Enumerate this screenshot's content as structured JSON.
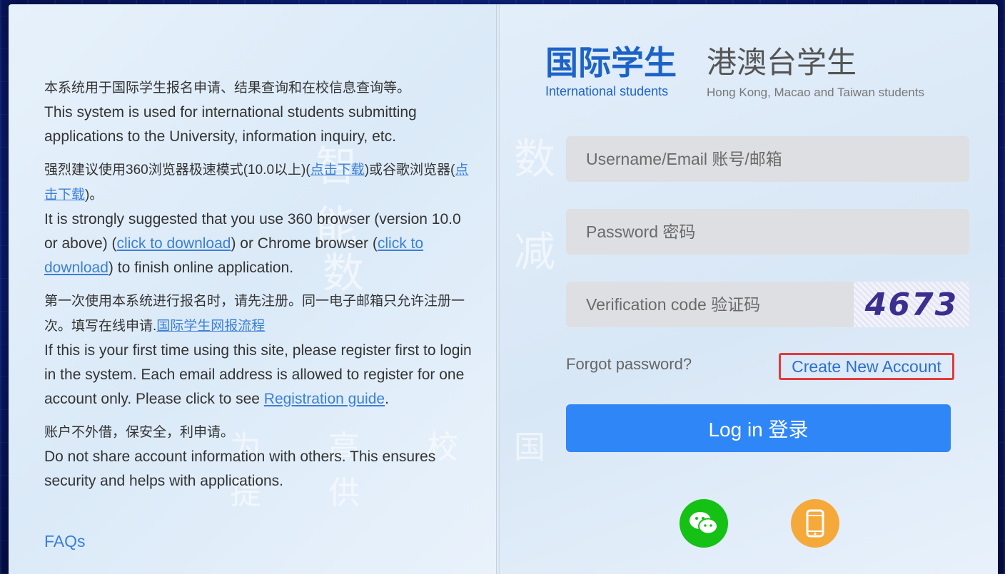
{
  "info": {
    "p1": {
      "cn": "本系统用于国际学生报名申请、结果查询和在校信息查询等。",
      "en": "This system is used for international students submitting applications to the University, information inquiry, etc."
    },
    "p2": {
      "cn_prefix": "强烈建议使用360浏览器极速模式(10.0以上)(",
      "cn_link1": "点击下载",
      "cn_mid": ")或谷歌浏览器(",
      "cn_link2": "点击下载",
      "cn_suffix": ")。",
      "en_prefix": "It is strongly suggested that you use 360 browser (version 10.0 or above) (",
      "en_link1": "click to download",
      "en_mid": ") or Chrome browser (",
      "en_link2": "click to download",
      "en_suffix": ") to finish online application."
    },
    "p3": {
      "cn_prefix": "第一次使用本系统进行报名时，请先注册。同一电子邮箱只允许注册一次。填写在线申请.",
      "cn_link": "国际学生网报流程",
      "en_prefix": "If this is your first time using this site, please register first to login in the system. Each email address is allowed to register for one account only. Please click to see ",
      "en_link": "Registration guide",
      "en_suffix": "."
    },
    "p4": {
      "cn": "账户不外借，保安全，利申请。",
      "en": "Do not share account information with others. This ensures security and helps with applications."
    },
    "faq": "FAQs"
  },
  "logo": {
    "intl_cn": "国际学生",
    "intl_en": "International students",
    "hmt_cn": "港澳台学生",
    "hmt_en": "Hong Kong, Macao and Taiwan students"
  },
  "form": {
    "username_placeholder": "Username/Email 账号/邮箱",
    "password_placeholder": "Password 密码",
    "captcha_placeholder": "Verification code 验证码",
    "captcha_text": "4673",
    "forgot": "Forgot password?",
    "create": "Create New Account",
    "login": "Log in 登录"
  },
  "colors": {
    "accent": "#2f86f6",
    "highlight": "#e23a3a",
    "wechat": "#14c114",
    "mobile": "#f6a93b"
  },
  "icons": [
    "wechat-icon",
    "mobile-phone-icon"
  ]
}
